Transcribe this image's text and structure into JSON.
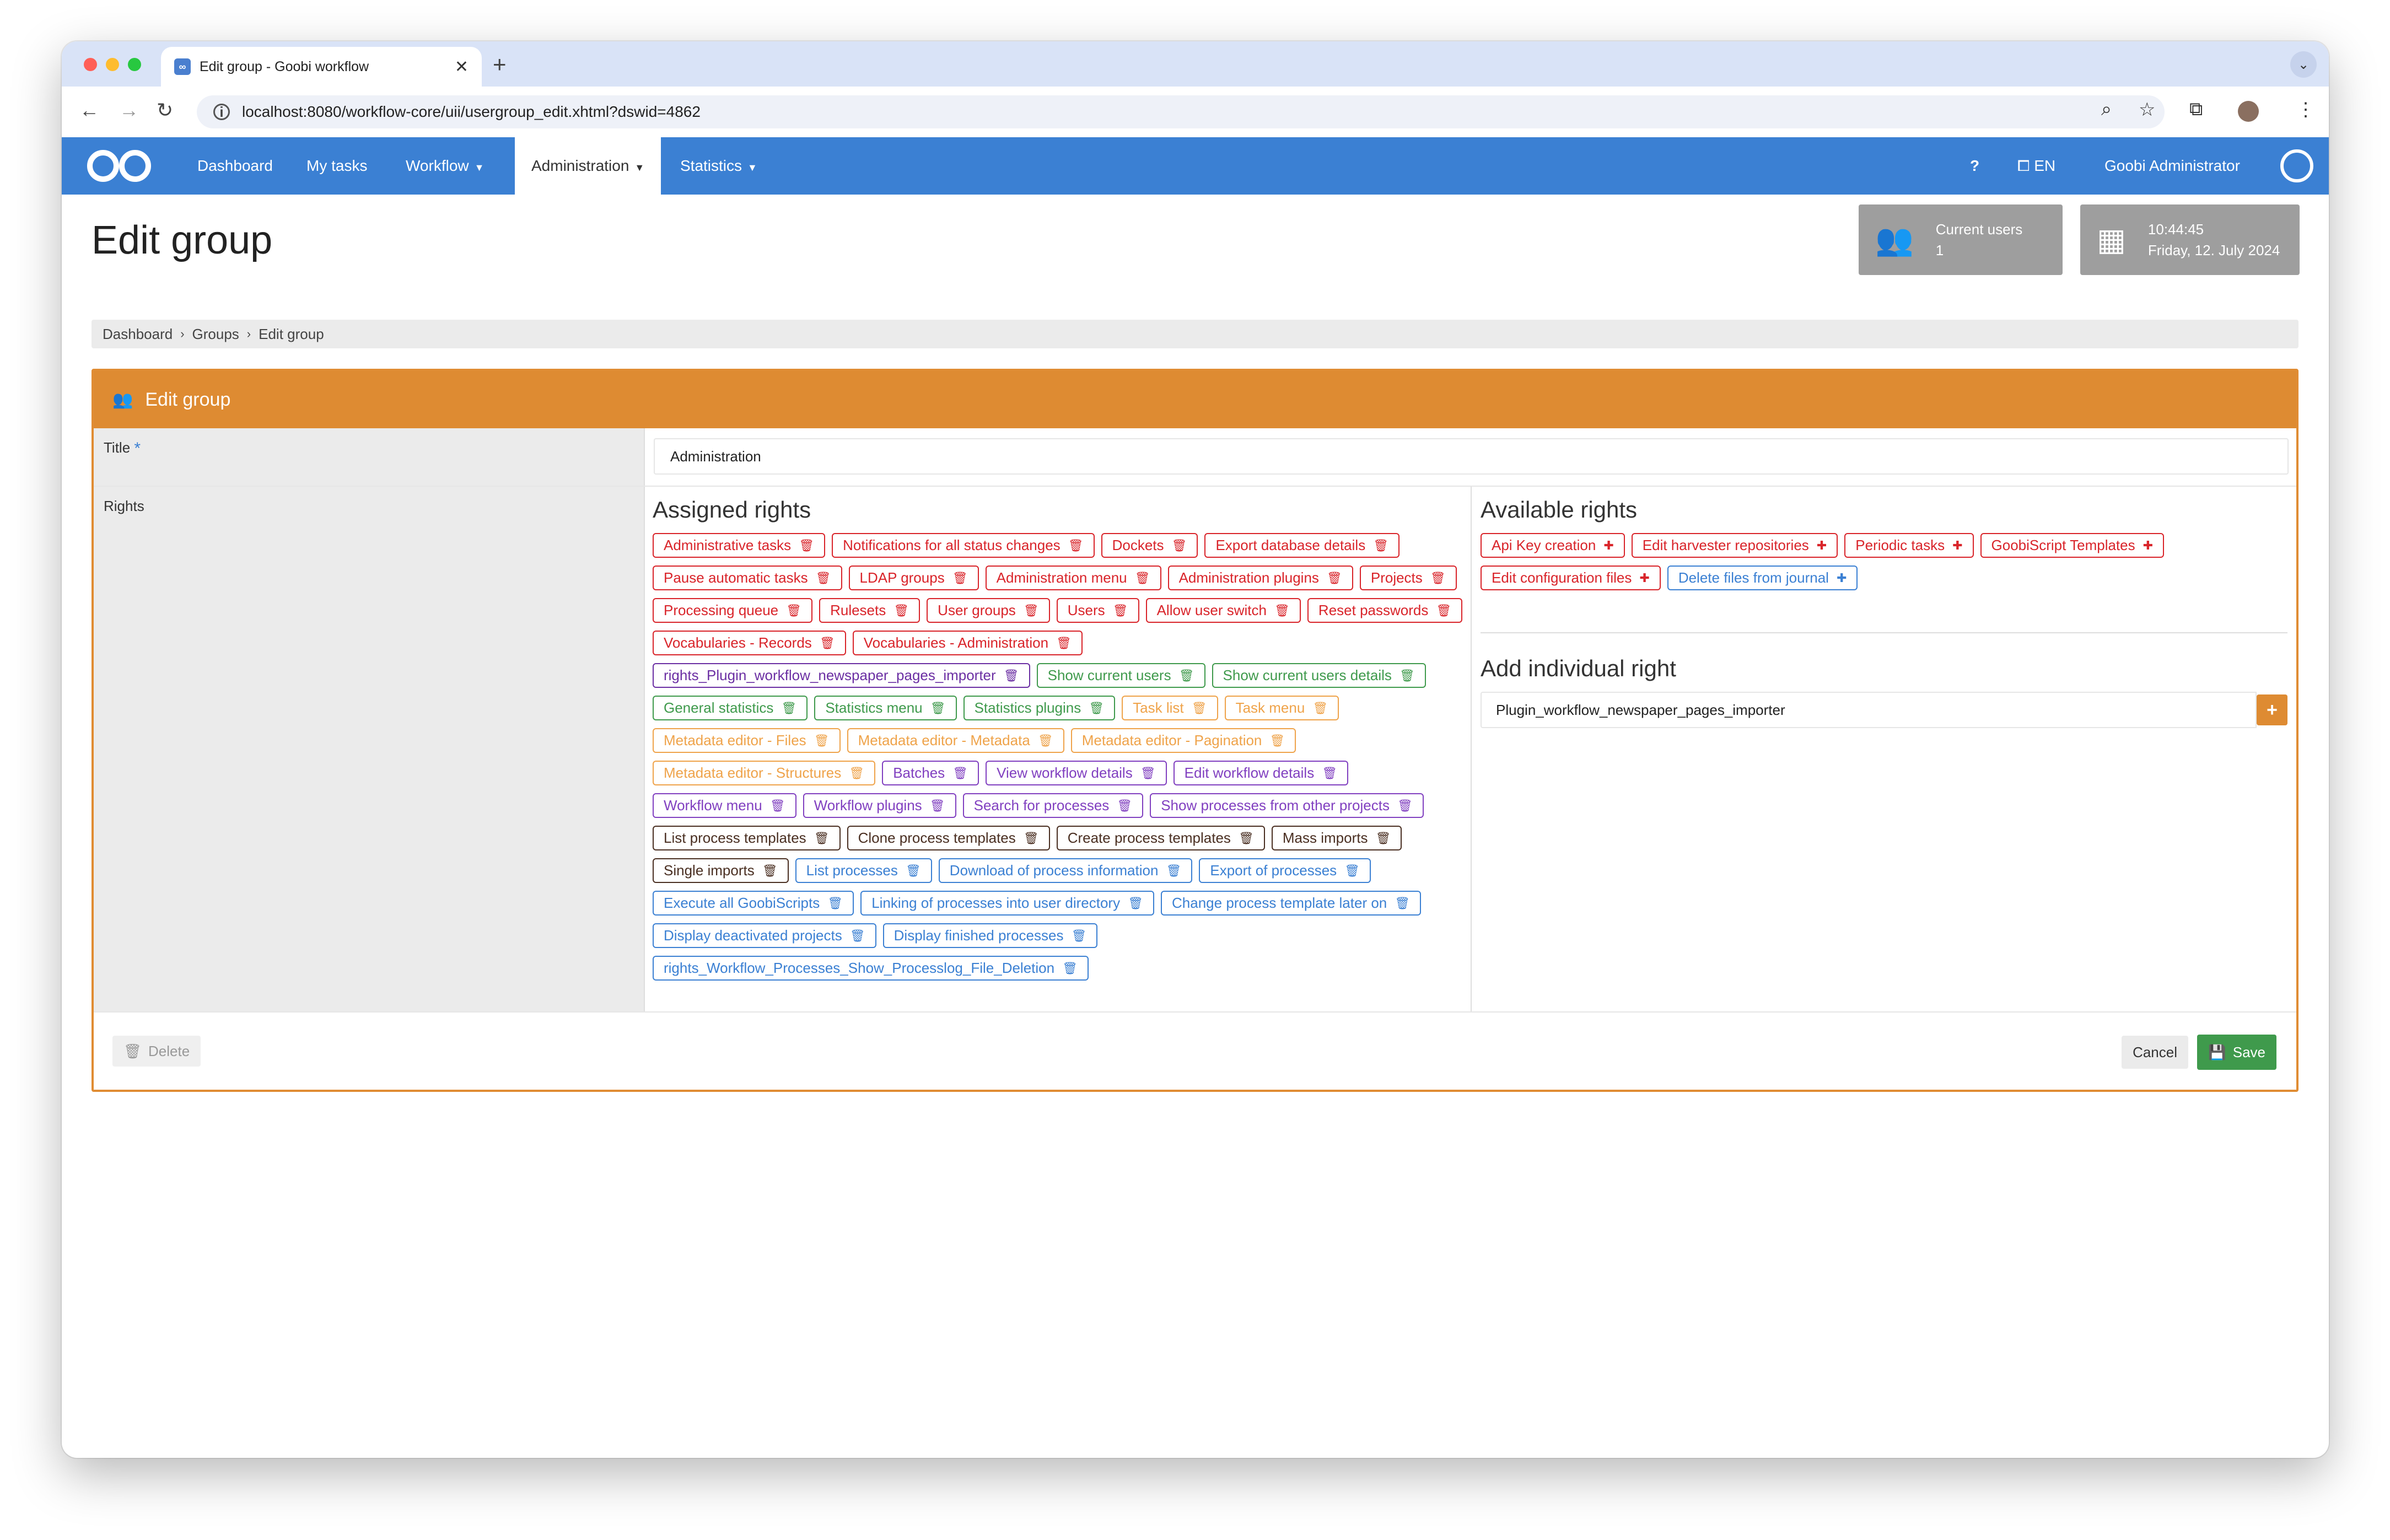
{
  "browser": {
    "tab_title": "Edit group - Goobi workflow",
    "new_tab": "+",
    "tab_close": "✕",
    "url": "localhost:8080/workflow-core/uii/usergroup_edit.xhtml?dswid=4862"
  },
  "nav": {
    "items": [
      "Dashboard",
      "My tasks",
      "Workflow",
      "Administration",
      "Statistics"
    ],
    "help": "?",
    "language": "EN",
    "user": "Goobi Administrator"
  },
  "page": {
    "title": "Edit group",
    "current_users_label": "Current users",
    "current_users_count": "1",
    "time": "10:44:45",
    "date": "Friday, 12. July 2024"
  },
  "breadcrumb": [
    "Dashboard",
    "Groups",
    "Edit group"
  ],
  "panel": {
    "header": "Edit group",
    "title_label": "Title",
    "title_value": "Administration",
    "rights_label": "Rights",
    "assigned_title": "Assigned rights",
    "available_title": "Available rights",
    "add_title": "Add individual right",
    "add_value": "Plugin_workflow_newspaper_pages_importer",
    "delete_label": "Delete",
    "cancel_label": "Cancel",
    "save_label": "Save"
  },
  "colors": {
    "red": "#d9242a",
    "purple": "#6b2fa3",
    "green": "#3f9a4c",
    "orange": "#efa34a",
    "violet": "#8140c0",
    "dark": "#4a2f22",
    "blue": "#3b80d3",
    "accent": "#de8b32"
  },
  "assigned_rights": [
    {
      "label": "Administrative tasks",
      "color": "red"
    },
    {
      "label": "Notifications for all status changes",
      "color": "red"
    },
    {
      "label": "Dockets",
      "color": "red"
    },
    {
      "label": "Export database details",
      "color": "red"
    },
    {
      "label": "Pause automatic tasks",
      "color": "red"
    },
    {
      "label": "LDAP groups",
      "color": "red"
    },
    {
      "label": "Administration menu",
      "color": "red"
    },
    {
      "label": "Administration plugins",
      "color": "red"
    },
    {
      "label": "Projects",
      "color": "red"
    },
    {
      "label": "Processing queue",
      "color": "red"
    },
    {
      "label": "Rulesets",
      "color": "red"
    },
    {
      "label": "User groups",
      "color": "red"
    },
    {
      "label": "Users",
      "color": "red"
    },
    {
      "label": "Allow user switch",
      "color": "red"
    },
    {
      "label": "Reset passwords",
      "color": "red"
    },
    {
      "label": "Vocabularies - Records",
      "color": "red"
    },
    {
      "label": "Vocabularies - Administration",
      "color": "red"
    },
    {
      "label": "rights_Plugin_workflow_newspaper_pages_importer",
      "color": "purple"
    },
    {
      "label": "Show current users",
      "color": "green"
    },
    {
      "label": "Show current users details",
      "color": "green"
    },
    {
      "label": "General statistics",
      "color": "green"
    },
    {
      "label": "Statistics menu",
      "color": "green"
    },
    {
      "label": "Statistics plugins",
      "color": "green"
    },
    {
      "label": "Task list",
      "color": "orange"
    },
    {
      "label": "Task menu",
      "color": "orange"
    },
    {
      "label": "Metadata editor - Files",
      "color": "orange"
    },
    {
      "label": "Metadata editor - Metadata",
      "color": "orange"
    },
    {
      "label": "Metadata editor - Pagination",
      "color": "orange"
    },
    {
      "label": "Metadata editor - Structures",
      "color": "orange"
    },
    {
      "label": "Batches",
      "color": "violet"
    },
    {
      "label": "View workflow details",
      "color": "violet"
    },
    {
      "label": "Edit workflow details",
      "color": "violet"
    },
    {
      "label": "Workflow menu",
      "color": "violet"
    },
    {
      "label": "Workflow plugins",
      "color": "violet"
    },
    {
      "label": "Search for processes",
      "color": "violet"
    },
    {
      "label": "Show processes from other projects",
      "color": "violet"
    },
    {
      "label": "List process templates",
      "color": "dark"
    },
    {
      "label": "Clone process templates",
      "color": "dark"
    },
    {
      "label": "Create process templates",
      "color": "dark"
    },
    {
      "label": "Mass imports",
      "color": "dark"
    },
    {
      "label": "Single imports",
      "color": "dark"
    },
    {
      "label": "List processes",
      "color": "blue"
    },
    {
      "label": "Download of process information",
      "color": "blue"
    },
    {
      "label": "Export of processes",
      "color": "blue"
    },
    {
      "label": "Execute all GoobiScripts",
      "color": "blue"
    },
    {
      "label": "Linking of processes into user directory",
      "color": "blue"
    },
    {
      "label": "Change process template later on",
      "color": "blue"
    },
    {
      "label": "Display deactivated projects",
      "color": "blue"
    },
    {
      "label": "Display finished processes",
      "color": "blue"
    },
    {
      "label": "rights_Workflow_Processes_Show_Processlog_File_Deletion",
      "color": "blue"
    }
  ],
  "available_rights": [
    {
      "label": "Api Key creation",
      "color": "red"
    },
    {
      "label": "Edit harvester repositories",
      "color": "red"
    },
    {
      "label": "Periodic tasks",
      "color": "red"
    },
    {
      "label": "GoobiScript Templates",
      "color": "red"
    },
    {
      "label": "Edit configuration files",
      "color": "red"
    },
    {
      "label": "Delete files from journal",
      "color": "blue"
    }
  ]
}
